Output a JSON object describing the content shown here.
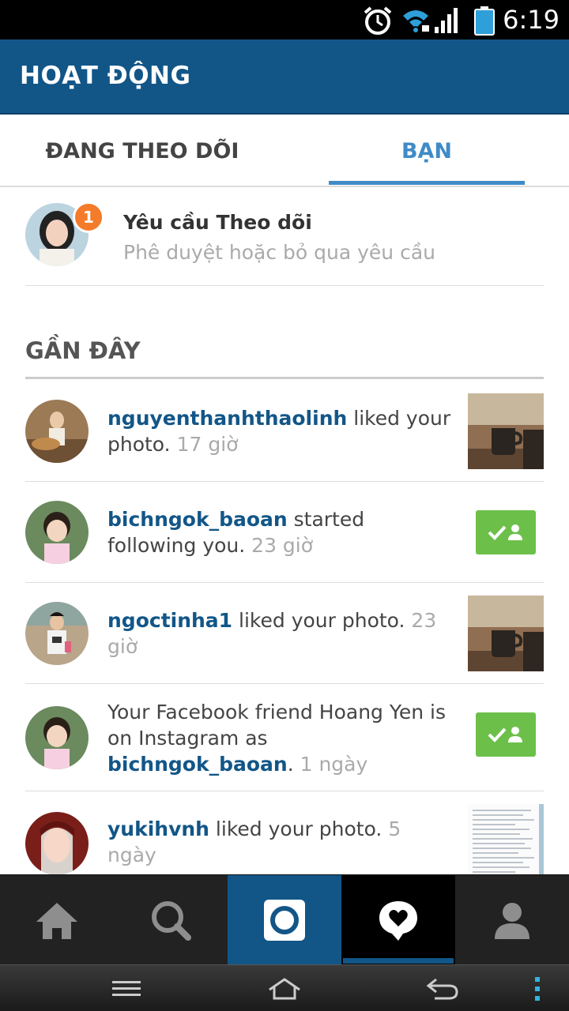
{
  "status_bar": {
    "time": "6:19",
    "icons": [
      "alarm-icon",
      "wifi-icon",
      "signal-icon",
      "battery-icon"
    ]
  },
  "header": {
    "title": "HOẠT ĐỘNG"
  },
  "tabs": [
    {
      "label": "ĐANG THEO DÕI",
      "active": false
    },
    {
      "label": "BẠN",
      "active": true
    }
  ],
  "follow_requests": {
    "title": "Yêu cầu Theo dõi",
    "subtitle": "Phê duyệt hoặc bỏ qua yêu cầu",
    "badge_count": "1"
  },
  "recent": {
    "heading": "GẦN ĐÂY",
    "items": [
      {
        "username": "nguyenthanhthaolinh",
        "action": " liked your photo. ",
        "time": "17 giờ",
        "trailing": "photo-thumbnail"
      },
      {
        "username": "bichngok_baoan",
        "action": " started following you. ",
        "time": "23 giờ",
        "trailing": "follow-back-button"
      },
      {
        "username": "ngoctinha1",
        "action": " liked your photo. ",
        "time": "23 giờ",
        "trailing": "photo-thumbnail"
      },
      {
        "prefix": "Your Facebook friend Hoang Yen is on Instagram as ",
        "username": "bichngok_baoan",
        "action": ". ",
        "time": "1 ngày",
        "trailing": "follow-back-button"
      },
      {
        "username": "yukihvnh",
        "action": " liked your photo. ",
        "time": "5 ngày",
        "trailing": "document-thumbnail"
      }
    ]
  },
  "bottom_nav": [
    "home-icon",
    "search-icon",
    "camera-icon",
    "activity-heart-icon",
    "profile-icon"
  ],
  "system_bar": [
    "menu-icon",
    "home-outline-icon",
    "back-icon",
    "overflow-icon"
  ],
  "colors": {
    "brand": "#125688",
    "tab_active": "#3f8bc7",
    "badge": "#f47b2a",
    "follow_green": "#6cc04a"
  }
}
